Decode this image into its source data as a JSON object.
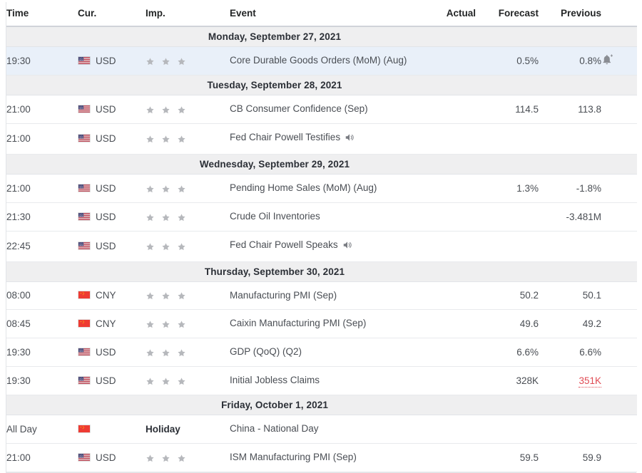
{
  "table": {
    "columns": [
      {
        "key": "time",
        "label": "Time"
      },
      {
        "key": "cur",
        "label": "Cur."
      },
      {
        "key": "imp",
        "label": "Imp."
      },
      {
        "key": "event",
        "label": "Event"
      },
      {
        "key": "actual",
        "label": "Actual"
      },
      {
        "key": "forecast",
        "label": "Forecast"
      },
      {
        "key": "previous",
        "label": "Previous"
      }
    ],
    "colors": {
      "day_header_bg": "#efeff0",
      "highlight_row_bg": "#e9f0f9",
      "row_border": "#e8eaed",
      "text": "#4a4e54",
      "heading_text": "#232526",
      "negative_value": "#e04b54",
      "star_filled": "#b6b8bc",
      "usd_flag_blue": "#3c3b6e",
      "usd_flag_red": "#b22234",
      "cny_flag_red": "#ee3b33",
      "cny_flag_star": "#ffde00"
    },
    "days": [
      {
        "label": "Monday, September 27, 2021",
        "rows": [
          {
            "time": "19:30",
            "currency": "USD",
            "flag": "us-flag-icon",
            "importance": 3,
            "importance_label": "",
            "event": "Core Durable Goods Orders (MoM) (Aug)",
            "event_icon": "",
            "actual": "",
            "forecast": "0.5%",
            "previous": "0.8%",
            "previous_state": "normal",
            "alert_icon": "bell-plus-icon",
            "highlighted": true
          }
        ]
      },
      {
        "label": "Tuesday, September 28, 2021",
        "rows": [
          {
            "time": "21:00",
            "currency": "USD",
            "flag": "us-flag-icon",
            "importance": 3,
            "importance_label": "",
            "event": "CB Consumer Confidence (Sep)",
            "event_icon": "",
            "actual": "",
            "forecast": "114.5",
            "previous": "113.8",
            "previous_state": "normal",
            "alert_icon": "",
            "highlighted": false
          },
          {
            "time": "21:00",
            "currency": "USD",
            "flag": "us-flag-icon",
            "importance": 3,
            "importance_label": "",
            "event": "Fed Chair Powell Testifies",
            "event_icon": "speaker-icon",
            "actual": "",
            "forecast": "",
            "previous": "",
            "previous_state": "normal",
            "alert_icon": "",
            "highlighted": false
          }
        ]
      },
      {
        "label": "Wednesday, September 29, 2021",
        "rows": [
          {
            "time": "21:00",
            "currency": "USD",
            "flag": "us-flag-icon",
            "importance": 3,
            "importance_label": "",
            "event": "Pending Home Sales (MoM) (Aug)",
            "event_icon": "",
            "actual": "",
            "forecast": "1.3%",
            "previous": "-1.8%",
            "previous_state": "normal",
            "alert_icon": "",
            "highlighted": false
          },
          {
            "time": "21:30",
            "currency": "USD",
            "flag": "us-flag-icon",
            "importance": 3,
            "importance_label": "",
            "event": "Crude Oil Inventories",
            "event_icon": "",
            "actual": "",
            "forecast": "",
            "previous": "-3.481M",
            "previous_state": "normal",
            "alert_icon": "",
            "highlighted": false
          },
          {
            "time": "22:45",
            "currency": "USD",
            "flag": "us-flag-icon",
            "importance": 3,
            "importance_label": "",
            "event": "Fed Chair Powell Speaks",
            "event_icon": "speaker-icon",
            "actual": "",
            "forecast": "",
            "previous": "",
            "previous_state": "normal",
            "alert_icon": "",
            "highlighted": false
          }
        ]
      },
      {
        "label": "Thursday, September 30, 2021",
        "rows": [
          {
            "time": "08:00",
            "currency": "CNY",
            "flag": "cn-flag-icon",
            "importance": 3,
            "importance_label": "",
            "event": "Manufacturing PMI (Sep)",
            "event_icon": "",
            "actual": "",
            "forecast": "50.2",
            "previous": "50.1",
            "previous_state": "normal",
            "alert_icon": "",
            "highlighted": false
          },
          {
            "time": "08:45",
            "currency": "CNY",
            "flag": "cn-flag-icon",
            "importance": 3,
            "importance_label": "",
            "event": "Caixin Manufacturing PMI (Sep)",
            "event_icon": "",
            "actual": "",
            "forecast": "49.6",
            "previous": "49.2",
            "previous_state": "normal",
            "alert_icon": "",
            "highlighted": false
          },
          {
            "time": "19:30",
            "currency": "USD",
            "flag": "us-flag-icon",
            "importance": 3,
            "importance_label": "",
            "event": "GDP (QoQ) (Q2)",
            "event_icon": "",
            "actual": "",
            "forecast": "6.6%",
            "previous": "6.6%",
            "previous_state": "normal",
            "alert_icon": "",
            "highlighted": false
          },
          {
            "time": "19:30",
            "currency": "USD",
            "flag": "us-flag-icon",
            "importance": 3,
            "importance_label": "",
            "event": "Initial Jobless Claims",
            "event_icon": "",
            "actual": "",
            "forecast": "328K",
            "previous": "351K",
            "previous_state": "negative",
            "alert_icon": "",
            "highlighted": false
          }
        ]
      },
      {
        "label": "Friday, October 1, 2021",
        "rows": [
          {
            "time": "All Day",
            "currency": "",
            "flag": "cn-flag-icon",
            "importance": 0,
            "importance_label": "Holiday",
            "event": "China - National Day",
            "event_icon": "",
            "actual": "",
            "forecast": "",
            "previous": "",
            "previous_state": "normal",
            "alert_icon": "",
            "highlighted": false
          },
          {
            "time": "21:00",
            "currency": "USD",
            "flag": "us-flag-icon",
            "importance": 3,
            "importance_label": "",
            "event": "ISM Manufacturing PMI (Sep)",
            "event_icon": "",
            "actual": "",
            "forecast": "59.5",
            "previous": "59.9",
            "previous_state": "normal",
            "alert_icon": "",
            "highlighted": false
          }
        ]
      }
    ]
  }
}
